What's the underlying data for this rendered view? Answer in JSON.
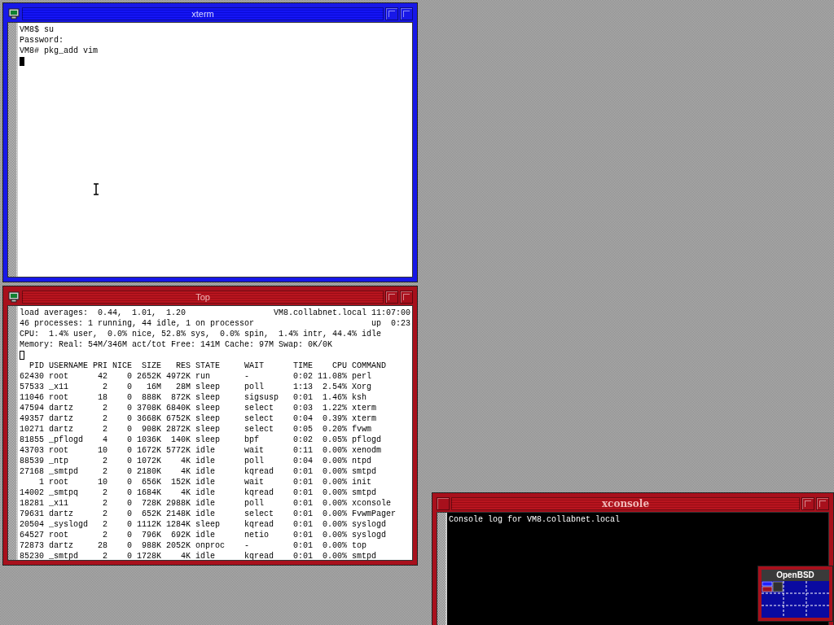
{
  "windows": [
    {
      "kind": "terminal",
      "title": "xterm",
      "focused": true,
      "lines": [
        "VM8$ su",
        "Password:",
        "VM8# pkg_add vim"
      ]
    },
    {
      "kind": "top",
      "title": "Top",
      "focused": false,
      "summary": [
        {
          "left": "load averages:  0.44,  1.01,  1.20",
          "right": "VM8.collabnet.local 11:07:00"
        },
        {
          "left": "46 processes: 1 running, 44 idle, 1 on processor",
          "right": "up  0:23"
        },
        {
          "left": "CPU:  1.4% user,  0.0% nice, 52.8% sys,  0.0% spin,  1.4% intr, 44.4% idle"
        },
        {
          "left": "Memory: Real: 54M/346M act/tot Free: 141M Cache: 97M Swap: 0K/0K"
        }
      ],
      "table": {
        "columns": [
          "PID",
          "USERNAME",
          "PRI",
          "NICE",
          "SIZE",
          "RES",
          "STATE",
          "WAIT",
          "TIME",
          "CPU",
          "COMMAND"
        ],
        "rows": [
          [
            "62430",
            "root",
            "42",
            "0",
            "2652K",
            "4972K",
            "run",
            "-",
            "0:02",
            "11.08%",
            "perl"
          ],
          [
            "57533",
            "_x11",
            "2",
            "0",
            "16M",
            "28M",
            "sleep",
            "poll",
            "1:13",
            "2.54%",
            "Xorg"
          ],
          [
            "11046",
            "root",
            "18",
            "0",
            "888K",
            "872K",
            "sleep",
            "sigsusp",
            "0:01",
            "1.46%",
            "ksh"
          ],
          [
            "47594",
            "dartz",
            "2",
            "0",
            "3708K",
            "6840K",
            "sleep",
            "select",
            "0:03",
            "1.22%",
            "xterm"
          ],
          [
            "49357",
            "dartz",
            "2",
            "0",
            "3668K",
            "6752K",
            "sleep",
            "select",
            "0:04",
            "0.39%",
            "xterm"
          ],
          [
            "10271",
            "dartz",
            "2",
            "0",
            "908K",
            "2872K",
            "sleep",
            "select",
            "0:05",
            "0.20%",
            "fvwm"
          ],
          [
            "81855",
            "_pflogd",
            "4",
            "0",
            "1036K",
            "140K",
            "sleep",
            "bpf",
            "0:02",
            "0.05%",
            "pflogd"
          ],
          [
            "43703",
            "root",
            "10",
            "0",
            "1672K",
            "5772K",
            "idle",
            "wait",
            "0:11",
            "0.00%",
            "xenodm"
          ],
          [
            "88539",
            "_ntp",
            "2",
            "0",
            "1072K",
            "4K",
            "idle",
            "poll",
            "0:04",
            "0.00%",
            "ntpd"
          ],
          [
            "27168",
            "_smtpd",
            "2",
            "0",
            "2180K",
            "4K",
            "idle",
            "kqread",
            "0:01",
            "0.00%",
            "smtpd"
          ],
          [
            "1",
            "root",
            "10",
            "0",
            "656K",
            "152K",
            "idle",
            "wait",
            "0:01",
            "0.00%",
            "init"
          ],
          [
            "14002",
            "_smtpq",
            "2",
            "0",
            "1684K",
            "4K",
            "idle",
            "kqread",
            "0:01",
            "0.00%",
            "smtpd"
          ],
          [
            "18281",
            "_x11",
            "2",
            "0",
            "728K",
            "2988K",
            "idle",
            "poll",
            "0:01",
            "0.00%",
            "xconsole"
          ],
          [
            "79631",
            "dartz",
            "2",
            "0",
            "652K",
            "2148K",
            "idle",
            "select",
            "0:01",
            "0.00%",
            "FvwmPager"
          ],
          [
            "20504",
            "_syslogd",
            "2",
            "0",
            "1112K",
            "1284K",
            "sleep",
            "kqread",
            "0:01",
            "0.00%",
            "syslogd"
          ],
          [
            "64527",
            "root",
            "2",
            "0",
            "796K",
            "692K",
            "idle",
            "netio",
            "0:01",
            "0.00%",
            "syslogd"
          ],
          [
            "72873",
            "dartz",
            "28",
            "0",
            "988K",
            "2052K",
            "onproc",
            "-",
            "0:01",
            "0.00%",
            "top"
          ],
          [
            "85230",
            "_smtpd",
            "2",
            "0",
            "1728K",
            "4K",
            "idle",
            "kqread",
            "0:01",
            "0.00%",
            "smtpd"
          ]
        ]
      }
    },
    {
      "kind": "console",
      "title": "xconsole",
      "focused": false,
      "lines": [
        "Console log for VM8.collabnet.local"
      ]
    },
    {
      "kind": "pager",
      "title": "OpenBSD"
    }
  ]
}
